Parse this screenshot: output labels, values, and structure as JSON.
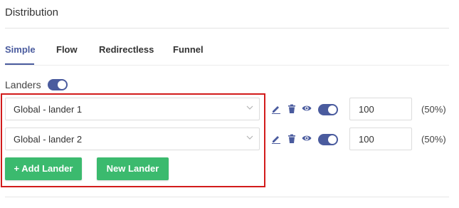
{
  "section": {
    "title": "Distribution"
  },
  "tabs": [
    {
      "label": "Simple",
      "active": true
    },
    {
      "label": "Flow",
      "active": false
    },
    {
      "label": "Redirectless",
      "active": false
    },
    {
      "label": "Funnel",
      "active": false
    }
  ],
  "landers": {
    "label": "Landers",
    "enabled": true,
    "rows": [
      {
        "name": "Global - lander 1",
        "weight": "100",
        "percent": "(50%)",
        "enabled": true
      },
      {
        "name": "Global - lander 2",
        "weight": "100",
        "percent": "(50%)",
        "enabled": true
      }
    ],
    "add_button": "+ Add Lander",
    "new_button": "New Lander"
  },
  "colors": {
    "accent": "#4a5b9e",
    "button_green": "#3bba6e",
    "highlight_red": "#d21b1b"
  },
  "icons": [
    "chevron-down-icon",
    "pencil-icon",
    "trash-icon",
    "eye-icon"
  ]
}
